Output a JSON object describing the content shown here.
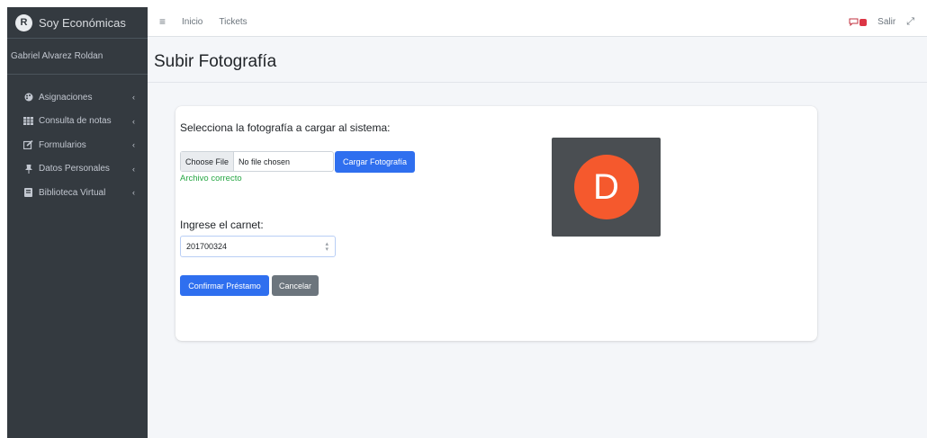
{
  "sidebar": {
    "brand": "Soy Económicas",
    "brand_logo_letter": "R",
    "user": "Gabriel Alvarez Roldan",
    "items": [
      {
        "label": "Asignaciones",
        "icon": "palette-icon"
      },
      {
        "label": "Consulta de notas",
        "icon": "table-icon"
      },
      {
        "label": "Formularios",
        "icon": "edit-icon"
      },
      {
        "label": "Datos Personales",
        "icon": "pushpin-icon"
      },
      {
        "label": "Biblioteca Virtual",
        "icon": "book-icon"
      }
    ]
  },
  "topbar": {
    "links": [
      "Inicio",
      "Tickets"
    ],
    "logout": "Salir"
  },
  "page": {
    "title": "Subir Fotografía"
  },
  "form": {
    "photo_label": "Selecciona la fotografía a cargar al sistema:",
    "file_button": "Choose File",
    "file_status": "No file chosen",
    "upload_button": "Cargar Fotografía",
    "valid_message": "Archivo correcto",
    "carnet_label": "Ingrese el carnet:",
    "carnet_value": "201700324",
    "confirm_button": "Confirmar Préstamo",
    "cancel_button": "Cancelar"
  },
  "avatar": {
    "letter": "D"
  },
  "colors": {
    "sidebar_bg": "#343a40",
    "primary": "#2f6fef",
    "secondary": "#6c757d",
    "success": "#28a745",
    "avatar_bg": "#f5592d",
    "badge": "#dc3545"
  }
}
